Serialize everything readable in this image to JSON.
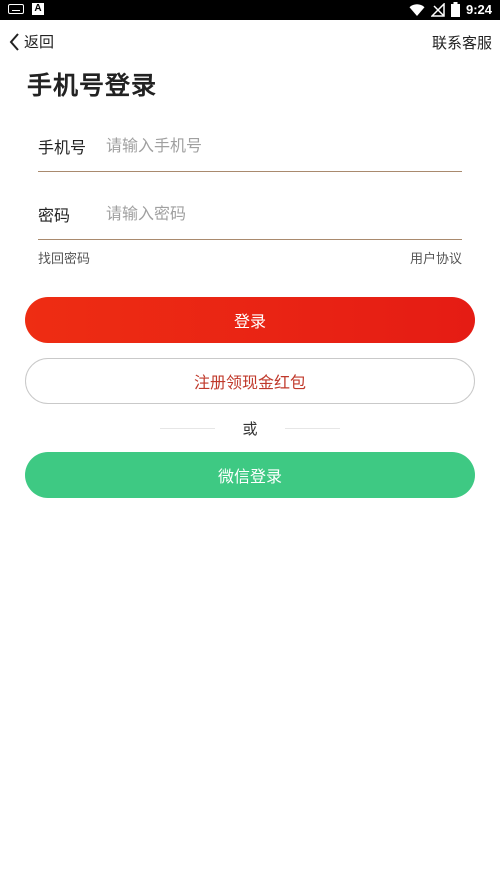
{
  "status_bar": {
    "time": "9:24"
  },
  "header": {
    "back_label": "返回",
    "contact_label": "联系客服"
  },
  "page": {
    "title": "手机号登录"
  },
  "form": {
    "phone": {
      "label": "手机号",
      "placeholder": "请输入手机号",
      "value": ""
    },
    "password": {
      "label": "密码",
      "placeholder": "请输入密码",
      "value": ""
    },
    "forgot_label": "找回密码",
    "agreement_label": "用户协议"
  },
  "buttons": {
    "login": "登录",
    "register": "注册领现金红包",
    "divider": "或",
    "wechat": "微信登录"
  },
  "colors": {
    "accent_red": "#e5261a",
    "wechat_green": "#3ec983",
    "register_text": "#c0392b"
  },
  "icons": {
    "status_left": [
      "keyboard-icon",
      "notification-a-icon"
    ],
    "status_right": [
      "wifi-icon",
      "no-signal-icon",
      "battery-icon"
    ],
    "back": "chevron-left-icon"
  }
}
